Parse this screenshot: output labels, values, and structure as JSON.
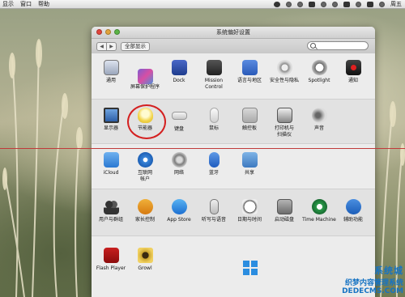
{
  "menubar": {
    "items": [
      "显示",
      "窗口",
      "帮助"
    ],
    "clock": "周五"
  },
  "window": {
    "title": "系统偏好设置",
    "show_all": "全部显示",
    "back": "◀",
    "forward": "▶"
  },
  "prefs": {
    "row1": [
      {
        "label": "通用"
      },
      {
        "label": "桌面与\n屏幕保护程序"
      },
      {
        "label": "Dock"
      },
      {
        "label": "Mission\nControl"
      },
      {
        "label": "语言与地区"
      },
      {
        "label": "安全性与隐私"
      },
      {
        "label": "Spotlight"
      },
      {
        "label": "通知"
      }
    ],
    "row2": [
      {
        "label": "显示器"
      },
      {
        "label": "节能器"
      },
      {
        "label": "键盘"
      },
      {
        "label": "鼠标"
      },
      {
        "label": "触控板"
      },
      {
        "label": "打印机与\n扫描仪"
      },
      {
        "label": "声音"
      }
    ],
    "row3": [
      {
        "label": "iCloud"
      },
      {
        "label": "互联网\n帐户"
      },
      {
        "label": "网络"
      },
      {
        "label": "蓝牙"
      },
      {
        "label": "共享"
      }
    ],
    "row4": [
      {
        "label": "用户与群组"
      },
      {
        "label": "家长控制"
      },
      {
        "label": "App Store"
      },
      {
        "label": "听写与语音"
      },
      {
        "label": "日期与时间"
      },
      {
        "label": "启动磁盘"
      },
      {
        "label": "Time Machine"
      },
      {
        "label": "辅助功能"
      }
    ],
    "row5": [
      {
        "label": "Flash Player"
      },
      {
        "label": "Growl"
      }
    ]
  },
  "watermark": {
    "line1": "系统城",
    "line2": "织梦内容管理系统",
    "line3": "DEDECMS.COM"
  }
}
